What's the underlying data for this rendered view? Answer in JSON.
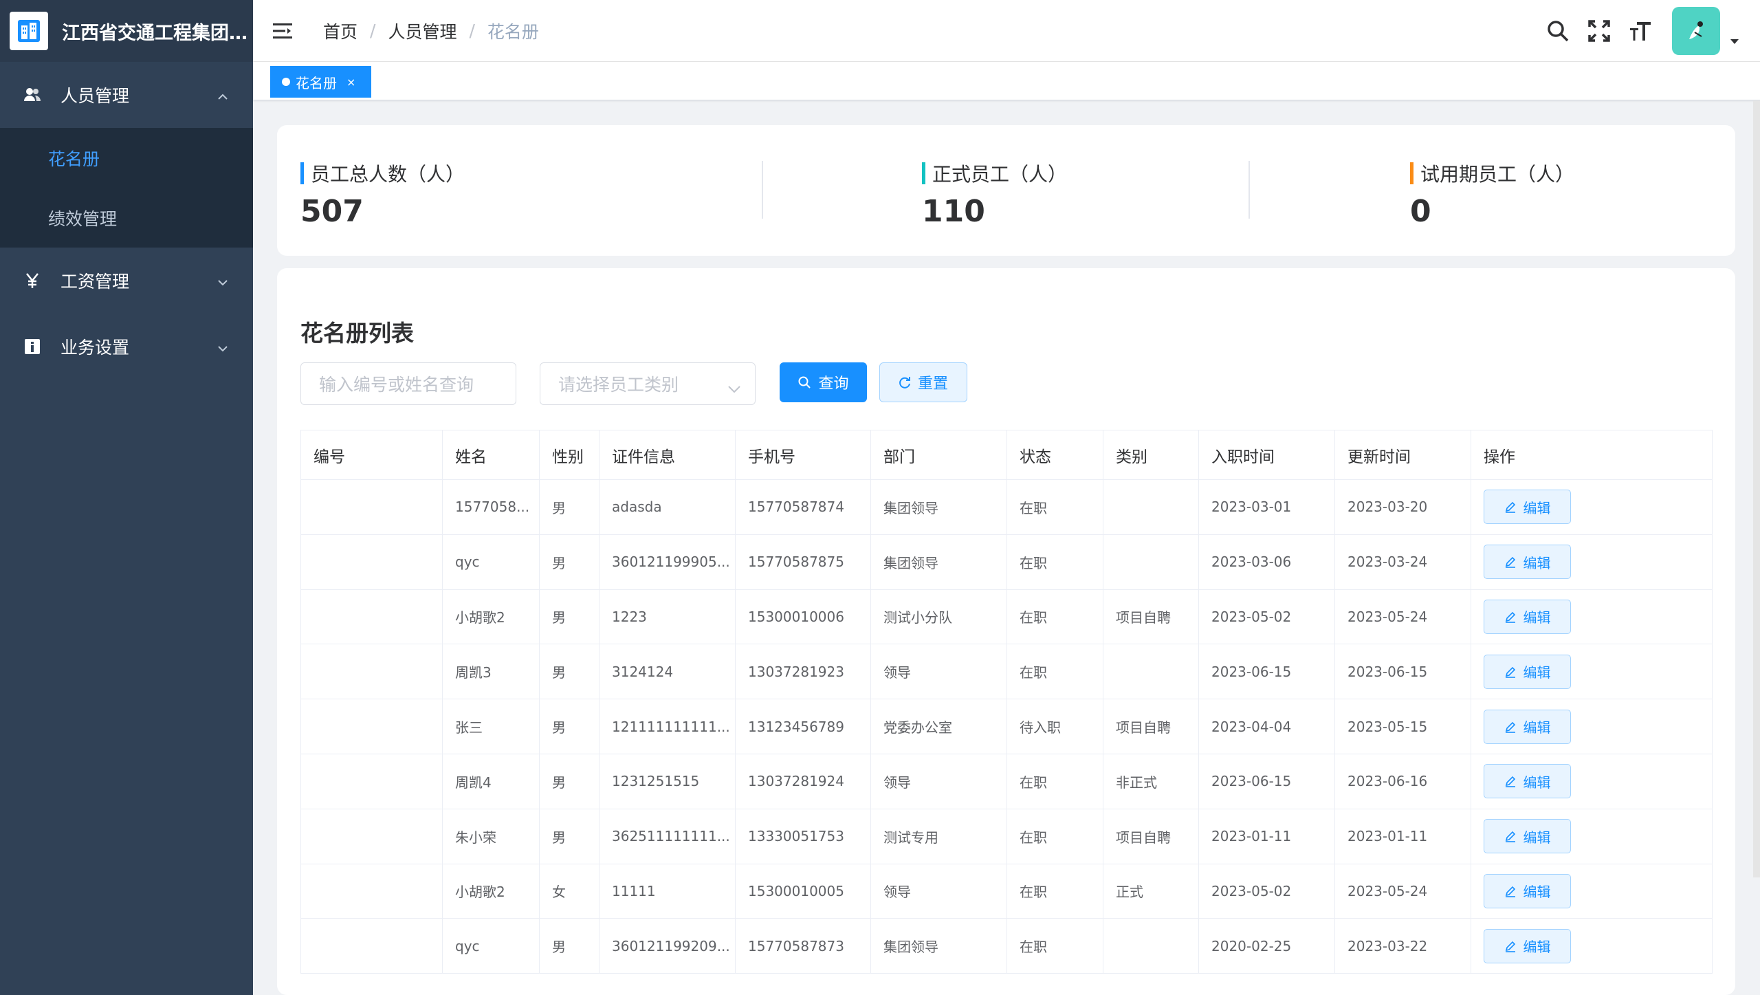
{
  "app": {
    "title": "江西省交通工程集团..."
  },
  "sidebar": {
    "groups": [
      {
        "label": "人员管理",
        "icon": "users-icon",
        "expanded": true,
        "items": [
          {
            "label": "花名册",
            "active": true
          },
          {
            "label": "绩效管理",
            "active": false
          }
        ]
      },
      {
        "label": "工资管理",
        "icon": "yen-icon",
        "expanded": false
      },
      {
        "label": "业务设置",
        "icon": "info-icon",
        "expanded": false
      }
    ]
  },
  "header": {
    "breadcrumb": [
      "首页",
      "人员管理",
      "花名册"
    ],
    "icons": [
      "search-icon",
      "fullscreen-icon",
      "font-size-icon"
    ]
  },
  "tags": [
    {
      "label": "花名册",
      "active": true
    }
  ],
  "stats": [
    {
      "label": "员工总人数（人）",
      "value": "507",
      "color": "#1890ff"
    },
    {
      "label": "正式员工（人）",
      "value": "110",
      "color": "#13c2c2"
    },
    {
      "label": "试用期员工（人）",
      "value": "0",
      "color": "#fa8c16"
    }
  ],
  "list": {
    "title": "花名册列表",
    "search_placeholder": "输入编号或姓名查询",
    "type_placeholder": "请选择员工类别",
    "query_label": "查询",
    "reset_label": "重置",
    "columns": [
      "编号",
      "姓名",
      "性别",
      "证件信息",
      "手机号",
      "部门",
      "状态",
      "类别",
      "入职时间",
      "更新时间",
      "操作"
    ],
    "edit_label": "编辑",
    "rows": [
      [
        "",
        "1577058...",
        "男",
        "adasda",
        "15770587874",
        "集团领导",
        "在职",
        "",
        "2023-03-01",
        "2023-03-20"
      ],
      [
        "",
        "qyc",
        "男",
        "360121199905...",
        "15770587875",
        "集团领导",
        "在职",
        "",
        "2023-03-06",
        "2023-03-24"
      ],
      [
        "",
        "小胡歌2",
        "男",
        "1223",
        "15300010006",
        "测试小分队",
        "在职",
        "项目自聘",
        "2023-05-02",
        "2023-05-24"
      ],
      [
        "",
        "周凯3",
        "男",
        "3124124",
        "13037281923",
        "领导",
        "在职",
        "",
        "2023-06-15",
        "2023-06-15"
      ],
      [
        "",
        "张三",
        "男",
        "121111111111...",
        "13123456789",
        "党委办公室",
        "待入职",
        "项目自聘",
        "2023-04-04",
        "2023-05-15"
      ],
      [
        "",
        "周凯4",
        "男",
        "1231251515",
        "13037281924",
        "领导",
        "在职",
        "非正式",
        "2023-06-15",
        "2023-06-16"
      ],
      [
        "",
        "朱小荣",
        "男",
        "362511111111...",
        "13330051753",
        "测试专用",
        "在职",
        "项目自聘",
        "2023-01-11",
        "2023-01-11"
      ],
      [
        "",
        "小胡歌2",
        "女",
        "11111",
        "15300010005",
        "领导",
        "在职",
        "正式",
        "2023-05-02",
        "2023-05-24"
      ],
      [
        "",
        "qyc",
        "男",
        "360121199209...",
        "15770587873",
        "集团领导",
        "在职",
        "",
        "2020-02-25",
        "2023-03-22"
      ]
    ]
  }
}
